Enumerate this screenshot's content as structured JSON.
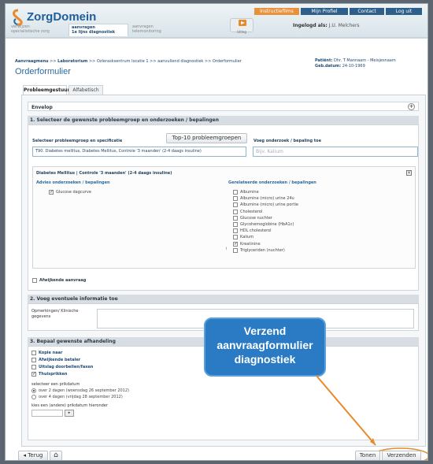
{
  "header": {
    "logo_text": "ZorgDomein",
    "nav": {
      "instructions": "Instructiefilms",
      "profile": "Mijn Profiel",
      "contact": "Contact",
      "logout": "Log uit"
    },
    "subtabs": [
      {
        "line1": "verwijzen",
        "line2": "specialistische zorg"
      },
      {
        "line1": "aanvragen",
        "line2": "1e lijns diagnostiek"
      },
      {
        "line1": "aanvragen",
        "line2": "telemonitoring"
      }
    ],
    "video_label": "Uitleg",
    "logged_in_label": "Ingelogd als:",
    "logged_in_name": "J.U. Melchers"
  },
  "breadcrumb": {
    "root": "Aanvraagmenu",
    "sep": ">>",
    "step2": "Laboratorium",
    "step3": "Ozlerasksentrum locatie 1",
    "step4": "aanvullend diagnostiek",
    "step5": "Orderformulier"
  },
  "page_title": "Orderformulier",
  "patient": {
    "label": "Patiënt:",
    "name": "Dhr. T Mannaam - Meisjesnaam",
    "dob_label": "Geb.datum:",
    "dob": "24-10-1969"
  },
  "tabs": [
    "Probleemgestuurd",
    "Alfabetisch"
  ],
  "envelop": {
    "title": "Envelop",
    "toggle": "+"
  },
  "section1": {
    "title": "1. Selecteer de gewenste probleemgroep en onderzoeken / bepalingen",
    "top10_button": "Top-10 probleemgroepen",
    "select_label": "Selecteer probleemgroep en specificatie",
    "select_value": "T90. Diabetes mellitus, Diabetes Mellitus, Controle '3 maanden' (2-4 daags insuline)",
    "add_label": "Voeg onderzoek / bepaling toe",
    "add_placeholder": "Bijv. Kalium",
    "group_title": "Diabetes Mellitus | Controle '3 maanden' (2-4 daags insuline)",
    "advice_title": "Advies onderzoeken / bepalingen",
    "advice_items": [
      {
        "label": "Glucose dagcurve",
        "checked": true
      }
    ],
    "related_title": "Gerelateerde onderzoeken / bepalingen",
    "related_items": [
      {
        "label": "Albumine",
        "checked": false
      },
      {
        "label": "Albumine (micro) urine 24u",
        "checked": false
      },
      {
        "label": "Albumine (micro) urine portie",
        "checked": false
      },
      {
        "label": "Cholesterol",
        "checked": false
      },
      {
        "label": "Glucose nuchter",
        "checked": false
      },
      {
        "label": "Glycohemoglobine (HbA1c)",
        "checked": false
      },
      {
        "label": "HDL cholesterol",
        "checked": false
      },
      {
        "label": "Kalium",
        "checked": false
      },
      {
        "label": "Kreatinine",
        "checked": true
      },
      {
        "label": "Triglyceriden (nuchter)",
        "checked": false
      }
    ],
    "deviant_label": "Afwijkende aanvraag"
  },
  "section2": {
    "title": "2. Voeg eventuele informatie toe",
    "remarks_label_1": "Opmerkingen/ Klinische",
    "remarks_label_2": "gegevens"
  },
  "section3": {
    "title": "3. Bepaal gewenste afhandeling",
    "options": [
      {
        "label": "Kopie naar",
        "checked": false
      },
      {
        "label": "Afwijkende betaler",
        "checked": false
      },
      {
        "label": "Uitslag doorbellen/faxen",
        "checked": false
      },
      {
        "label": "Thuisprikken",
        "checked": true
      }
    ],
    "date_label": "selecteer een prikdatum",
    "date_options": [
      {
        "label": "over 2 dagen (woensdag 26 september 2012)",
        "selected": true
      },
      {
        "label": "over 4 dagen (vrijdag 28 september 2012)",
        "selected": false
      }
    ],
    "other_date_label": "kies een (andere) prikdatum hieronder"
  },
  "callout": {
    "line1": "Verzend",
    "line2": "aanvraagformulier",
    "line3": "diagnostiek"
  },
  "footer": {
    "back": "Terug",
    "show": "Tonen",
    "send": "Verzenden"
  },
  "colors": {
    "accent": "#2a7bc4",
    "highlight": "#e88a2a",
    "link": "#1f4a73"
  }
}
